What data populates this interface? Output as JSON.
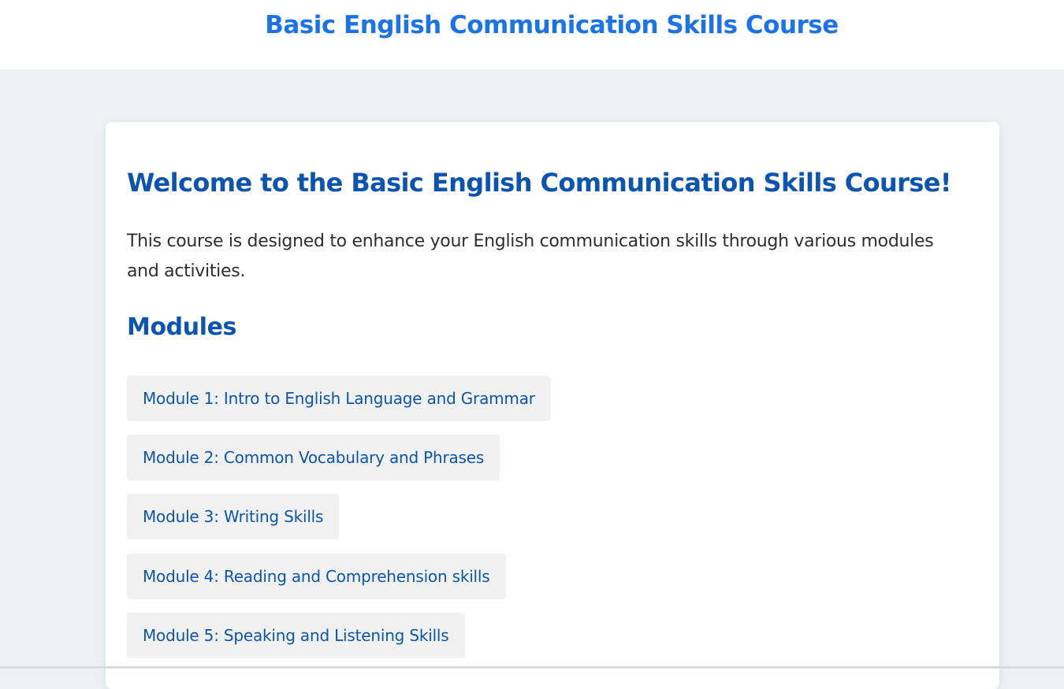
{
  "header": {
    "title": "Basic English Communication Skills Course"
  },
  "main": {
    "welcome_heading": "Welcome to the Basic English Communication Skills Course!",
    "intro": "This course is designed to enhance your English communication skills through various modules and activities.",
    "modules_heading": "Modules",
    "modules": [
      {
        "label": "Module 1: Intro to English Language and Grammar"
      },
      {
        "label": "Module 2: Common Vocabulary and Phrases"
      },
      {
        "label": "Module 3: Writing Skills"
      },
      {
        "label": "Module 4: Reading and Comprehension skills"
      },
      {
        "label": "Module 5: Speaking and Listening Skills"
      }
    ]
  },
  "colors": {
    "header_title": "#1a73e8",
    "heading": "#0b55b0",
    "page_background": "#eef1f2",
    "module_background": "#f1f1f2"
  }
}
